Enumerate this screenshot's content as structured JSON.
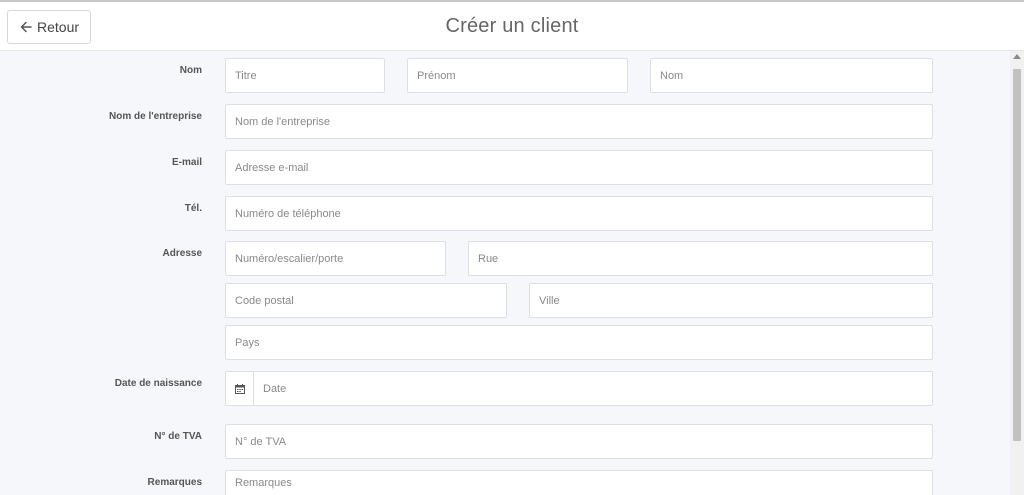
{
  "header": {
    "back_label": "Retour",
    "title": "Créer un client"
  },
  "form": {
    "labels": {
      "name": "Nom",
      "company": "Nom de l'entreprise",
      "email": "E-mail",
      "phone": "Tél.",
      "address": "Adresse",
      "birthdate": "Date de naissance",
      "vat": "N° de TVA",
      "remarks": "Remarques"
    },
    "placeholders": {
      "title": "Titre",
      "first_name": "Prénom",
      "last_name": "Nom",
      "company": "Nom de l'entreprise",
      "email": "Adresse e-mail",
      "phone": "Numéro de téléphone",
      "street_number": "Numéro/escalier/porte",
      "street": "Rue",
      "postal_code": "Code postal",
      "city": "Ville",
      "country": "Pays",
      "date": "Date",
      "vat": "N° de TVA",
      "remarks": "Remarques"
    }
  },
  "icons": {
    "back": "arrow-left-icon",
    "calendar": "calendar-icon"
  }
}
